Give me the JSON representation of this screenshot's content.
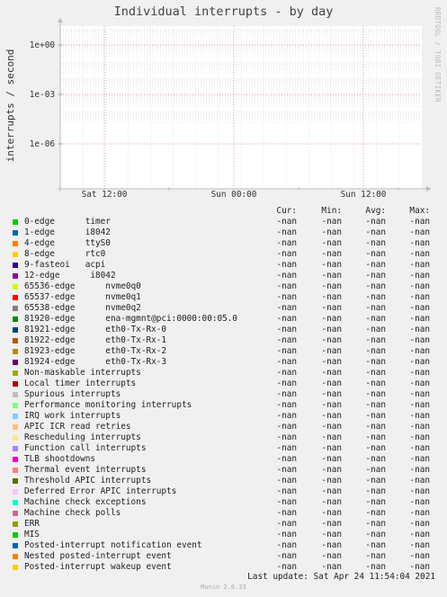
{
  "chart_data": {
    "type": "line",
    "title": "Individual interrupts - by day",
    "ylabel": "interrupts / second",
    "yscale": "log",
    "yticks": [
      "1e+00",
      "1e-03",
      "1e-06"
    ],
    "xticks": [
      "Sat 12:00",
      "Sun 00:00",
      "Sun 12:00"
    ],
    "grid": true,
    "legend_columns": [
      "Cur:",
      "Min:",
      "Avg:",
      "Max:"
    ],
    "series": [
      {
        "name": "0-edge      timer",
        "color": "#00cc00",
        "cur": "-nan",
        "min": "-nan",
        "avg": "-nan",
        "max": "-nan"
      },
      {
        "name": "1-edge      i8042",
        "color": "#0066b3",
        "cur": "-nan",
        "min": "-nan",
        "avg": "-nan",
        "max": "-nan"
      },
      {
        "name": "4-edge      ttyS0",
        "color": "#ff8000",
        "cur": "-nan",
        "min": "-nan",
        "avg": "-nan",
        "max": "-nan"
      },
      {
        "name": "8-edge      rtc0",
        "color": "#ffcc00",
        "cur": "-nan",
        "min": "-nan",
        "avg": "-nan",
        "max": "-nan"
      },
      {
        "name": "9-fasteoi   acpi",
        "color": "#330099",
        "cur": "-nan",
        "min": "-nan",
        "avg": "-nan",
        "max": "-nan"
      },
      {
        "name": "12-edge      i8042",
        "color": "#990099",
        "cur": "-nan",
        "min": "-nan",
        "avg": "-nan",
        "max": "-nan"
      },
      {
        "name": "65536-edge      nvme0q0",
        "color": "#ccff00",
        "cur": "-nan",
        "min": "-nan",
        "avg": "-nan",
        "max": "-nan"
      },
      {
        "name": "65537-edge      nvme0q1",
        "color": "#ff0000",
        "cur": "-nan",
        "min": "-nan",
        "avg": "-nan",
        "max": "-nan"
      },
      {
        "name": "65538-edge      nvme0q2",
        "color": "#808080",
        "cur": "-nan",
        "min": "-nan",
        "avg": "-nan",
        "max": "-nan"
      },
      {
        "name": "81920-edge      ena-mgmnt@pci:0000:00:05.0",
        "color": "#008f00",
        "cur": "-nan",
        "min": "-nan",
        "avg": "-nan",
        "max": "-nan"
      },
      {
        "name": "81921-edge      eth0-Tx-Rx-0",
        "color": "#00487d",
        "cur": "-nan",
        "min": "-nan",
        "avg": "-nan",
        "max": "-nan"
      },
      {
        "name": "81922-edge      eth0-Tx-Rx-1",
        "color": "#b35a00",
        "cur": "-nan",
        "min": "-nan",
        "avg": "-nan",
        "max": "-nan"
      },
      {
        "name": "81923-edge      eth0-Tx-Rx-2",
        "color": "#b38f00",
        "cur": "-nan",
        "min": "-nan",
        "avg": "-nan",
        "max": "-nan"
      },
      {
        "name": "81924-edge      eth0-Tx-Rx-3",
        "color": "#6b006b",
        "cur": "-nan",
        "min": "-nan",
        "avg": "-nan",
        "max": "-nan"
      },
      {
        "name": "Non-maskable interrupts",
        "color": "#8fb300",
        "cur": "-nan",
        "min": "-nan",
        "avg": "-nan",
        "max": "-nan"
      },
      {
        "name": "Local timer interrupts",
        "color": "#b30000",
        "cur": "-nan",
        "min": "-nan",
        "avg": "-nan",
        "max": "-nan"
      },
      {
        "name": "Spurious interrupts",
        "color": "#bebebe",
        "cur": "-nan",
        "min": "-nan",
        "avg": "-nan",
        "max": "-nan"
      },
      {
        "name": "Performance monitoring interrupts",
        "color": "#80ff80",
        "cur": "-nan",
        "min": "-nan",
        "avg": "-nan",
        "max": "-nan"
      },
      {
        "name": "IRQ work interrupts",
        "color": "#80c9ff",
        "cur": "-nan",
        "min": "-nan",
        "avg": "-nan",
        "max": "-nan"
      },
      {
        "name": "APIC ICR read retries",
        "color": "#ffc080",
        "cur": "-nan",
        "min": "-nan",
        "avg": "-nan",
        "max": "-nan"
      },
      {
        "name": "Rescheduling interrupts",
        "color": "#ffe680",
        "cur": "-nan",
        "min": "-nan",
        "avg": "-nan",
        "max": "-nan"
      },
      {
        "name": "Function call interrupts",
        "color": "#aa80ff",
        "cur": "-nan",
        "min": "-nan",
        "avg": "-nan",
        "max": "-nan"
      },
      {
        "name": "TLB shootdowns",
        "color": "#ee00cc",
        "cur": "-nan",
        "min": "-nan",
        "avg": "-nan",
        "max": "-nan"
      },
      {
        "name": "Thermal event interrupts",
        "color": "#ff8080",
        "cur": "-nan",
        "min": "-nan",
        "avg": "-nan",
        "max": "-nan"
      },
      {
        "name": "Threshold APIC interrupts",
        "color": "#666600",
        "cur": "-nan",
        "min": "-nan",
        "avg": "-nan",
        "max": "-nan"
      },
      {
        "name": "Deferred Error APIC interrupts",
        "color": "#ffbfff",
        "cur": "-nan",
        "min": "-nan",
        "avg": "-nan",
        "max": "-nan"
      },
      {
        "name": "Machine check exceptions",
        "color": "#00ffcc",
        "cur": "-nan",
        "min": "-nan",
        "avg": "-nan",
        "max": "-nan"
      },
      {
        "name": "Machine check polls",
        "color": "#cc6699",
        "cur": "-nan",
        "min": "-nan",
        "avg": "-nan",
        "max": "-nan"
      },
      {
        "name": "ERR",
        "color": "#999900",
        "cur": "-nan",
        "min": "-nan",
        "avg": "-nan",
        "max": "-nan"
      },
      {
        "name": "MIS",
        "color": "#00cc00",
        "cur": "-nan",
        "min": "-nan",
        "avg": "-nan",
        "max": "-nan"
      },
      {
        "name": "Posted-interrupt notification event",
        "color": "#0066b3",
        "cur": "-nan",
        "min": "-nan",
        "avg": "-nan",
        "max": "-nan"
      },
      {
        "name": "Nested posted-interrupt event",
        "color": "#ff8000",
        "cur": "-nan",
        "min": "-nan",
        "avg": "-nan",
        "max": "-nan"
      },
      {
        "name": "Posted-interrupt wakeup event",
        "color": "#ffcc00",
        "cur": "-nan",
        "min": "-nan",
        "avg": "-nan",
        "max": "-nan"
      }
    ]
  },
  "footer": {
    "last_update": "Last update:  Sat Apr 24 11:54:04 2021",
    "munin": "Munin 2.0.33"
  },
  "side_label": "RRDTOOL / TOBI OETIKER"
}
